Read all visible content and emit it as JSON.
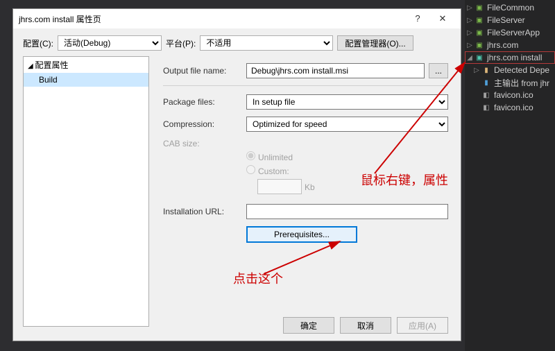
{
  "dialog": {
    "title": "jhrs.com install 属性页",
    "help": "?",
    "close": "✕",
    "configLabel": "配置(C):",
    "configValue": "活动(Debug)",
    "platformLabel": "平台(P):",
    "platformValue": "不适用",
    "configMgr": "配置管理器(O)..."
  },
  "tree": {
    "root": "配置属性",
    "build": "Build"
  },
  "form": {
    "outputLabel": "Output file name:",
    "outputValue": "Debug\\jhrs.com install.msi",
    "browse": "...",
    "packageLabel": "Package files:",
    "packageValue": "In setup file",
    "compressLabel": "Compression:",
    "compressValue": "Optimized for speed",
    "cabLabel": "CAB size:",
    "radioUnlimited": "Unlimited",
    "radioCustom": "Custom:",
    "kb": "Kb",
    "installUrlLabel": "Installation URL:",
    "installUrlValue": "",
    "prereq": "Prerequisites..."
  },
  "footer": {
    "ok": "确定",
    "cancel": "取消",
    "apply": "应用(A)"
  },
  "sidebar": {
    "items": [
      {
        "label": "FileCommon"
      },
      {
        "label": "FileServer"
      },
      {
        "label": "FileServerApp"
      },
      {
        "label": "jhrs.com"
      },
      {
        "label": "jhrs.com install"
      },
      {
        "label": "Detected Depe"
      },
      {
        "label": "主输出 from jhr"
      },
      {
        "label": "favicon.ico"
      },
      {
        "label": "favicon.ico"
      }
    ]
  },
  "annotations": {
    "rightClick": "鼠标右键，属性",
    "clickThis": "点击这个"
  }
}
